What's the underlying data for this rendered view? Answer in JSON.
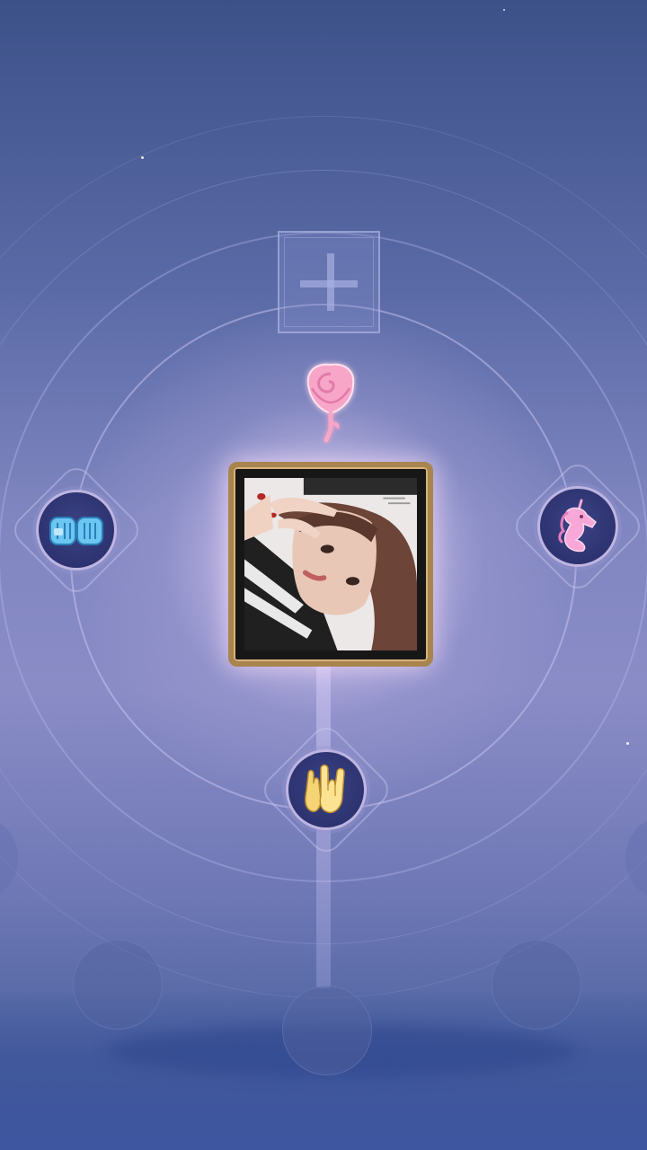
{
  "wheel": {
    "add_slot": {
      "icon": "plus-icon"
    },
    "selected_item": {
      "icon": "rose-icon",
      "color": "#f7a6c8"
    },
    "center_avatar": {
      "icon": "player-avatar-photo",
      "frame_color": "#a8854e"
    },
    "emotes": [
      {
        "position": "left",
        "icon": "fist-bump-icon",
        "color": "#6cc6f2"
      },
      {
        "position": "right",
        "icon": "unicorn-icon",
        "color": "#f7a8d8"
      },
      {
        "position": "bottom",
        "icon": "clapping-hands-icon",
        "color": "#f5d476"
      }
    ],
    "empty_slots": 3
  },
  "colors": {
    "background_top": "#3d5189",
    "background_mid": "#8a8cc6",
    "ring": "#cdc8f5"
  }
}
